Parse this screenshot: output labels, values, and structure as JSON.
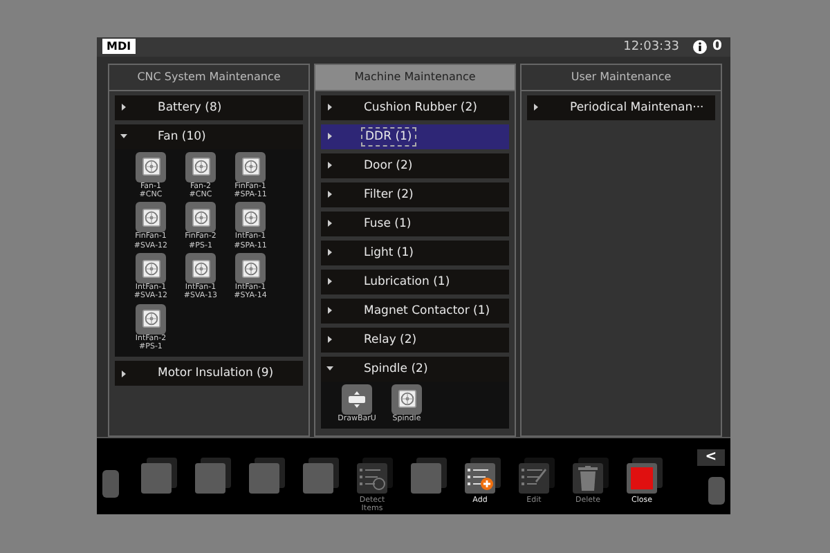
{
  "header": {
    "mode": "MDI",
    "time": "12:03:33",
    "alarm_count": "0"
  },
  "panels": [
    {
      "title": "CNC System Maintenance",
      "selected": false,
      "items": [
        {
          "label": "Battery (8)",
          "expanded": false,
          "selected": false
        },
        {
          "label": "Fan (10)",
          "expanded": true,
          "selected": false,
          "children": [
            {
              "kind": "fan",
              "line1": "Fan-1",
              "line2": "#CNC"
            },
            {
              "kind": "fan",
              "line1": "Fan-2",
              "line2": "#CNC"
            },
            {
              "kind": "fan",
              "line1": "FinFan-1",
              "line2": "#SPA-11"
            },
            {
              "kind": "fan",
              "line1": "FinFan-1",
              "line2": "#SVA-12"
            },
            {
              "kind": "fan",
              "line1": "FinFan-2",
              "line2": "#PS-1"
            },
            {
              "kind": "fan",
              "line1": "IntFan-1",
              "line2": "#SPA-11"
            },
            {
              "kind": "fan",
              "line1": "IntFan-1",
              "line2": "#SVA-12"
            },
            {
              "kind": "fan",
              "line1": "IntFan-1",
              "line2": "#SVA-13"
            },
            {
              "kind": "fan",
              "line1": "IntFan-1",
              "line2": "#SYA-14"
            },
            {
              "kind": "fan",
              "line1": "IntFan-2",
              "line2": "#PS-1"
            }
          ]
        },
        {
          "label": "Motor Insulation (9)",
          "expanded": false,
          "selected": false
        }
      ]
    },
    {
      "title": "Machine Maintenance",
      "selected": true,
      "items": [
        {
          "label": "Cushion Rubber (2)",
          "expanded": false,
          "selected": false
        },
        {
          "label": "DDR (1)",
          "expanded": false,
          "selected": true
        },
        {
          "label": "Door (2)",
          "expanded": false,
          "selected": false
        },
        {
          "label": "Filter (2)",
          "expanded": false,
          "selected": false
        },
        {
          "label": "Fuse (1)",
          "expanded": false,
          "selected": false
        },
        {
          "label": "Light (1)",
          "expanded": false,
          "selected": false
        },
        {
          "label": "Lubrication (1)",
          "expanded": false,
          "selected": false
        },
        {
          "label": "Magnet Contactor (1)",
          "expanded": false,
          "selected": false
        },
        {
          "label": "Relay (2)",
          "expanded": false,
          "selected": false
        },
        {
          "label": "Spindle (2)",
          "expanded": true,
          "selected": false,
          "children": [
            {
              "kind": "drawbar",
              "line1": "DrawBarU"
            },
            {
              "kind": "fan",
              "line1": "Spindle"
            }
          ]
        }
      ]
    },
    {
      "title": "User Maintenance",
      "selected": false,
      "items": [
        {
          "label": "Periodical Maintenan···",
          "expanded": false,
          "selected": false
        }
      ]
    }
  ],
  "softkeys": [
    {
      "kind": "blank",
      "disabled": false
    },
    {
      "kind": "blank",
      "disabled": false
    },
    {
      "kind": "blank",
      "disabled": false
    },
    {
      "kind": "blank",
      "disabled": false
    },
    {
      "kind": "detect",
      "label": "Detect Items",
      "disabled": true
    },
    {
      "kind": "blank",
      "disabled": false
    },
    {
      "kind": "add",
      "label": "Add",
      "disabled": false
    },
    {
      "kind": "edit",
      "label": "Edit",
      "disabled": true
    },
    {
      "kind": "delete",
      "label": "Delete",
      "disabled": true
    },
    {
      "kind": "close",
      "label": "Close",
      "disabled": false
    }
  ],
  "back_button": "<"
}
